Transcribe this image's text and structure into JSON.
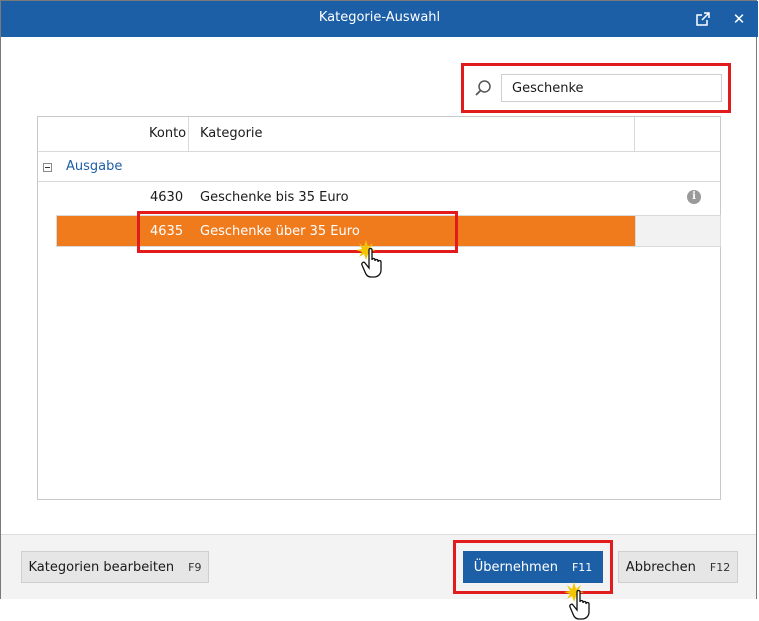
{
  "window": {
    "title": "Kategorie-Auswahl",
    "popout_icon": "external-link-icon",
    "close_label": "✕"
  },
  "search": {
    "value": "Geschenke",
    "icon": "search-icon"
  },
  "grid": {
    "columns": {
      "konto": "Konto",
      "kategorie": "Kategorie"
    },
    "group": {
      "label": "Ausgabe",
      "expander": "−"
    },
    "rows": [
      {
        "konto": "4630",
        "kategorie": "Geschenke bis 35 Euro",
        "info": "i"
      },
      {
        "konto": "4635",
        "kategorie": "Geschenke über 35 Euro"
      }
    ]
  },
  "footer": {
    "edit_label": "Kategorien bearbeiten",
    "edit_key": "F9",
    "apply_label": "Übernehmen",
    "apply_key": "F11",
    "cancel_label": "Abbrechen",
    "cancel_key": "F12"
  },
  "colors": {
    "accent": "#1c5fa6",
    "selection": "#f07b1d",
    "highlight_box": "#e21c1c"
  }
}
